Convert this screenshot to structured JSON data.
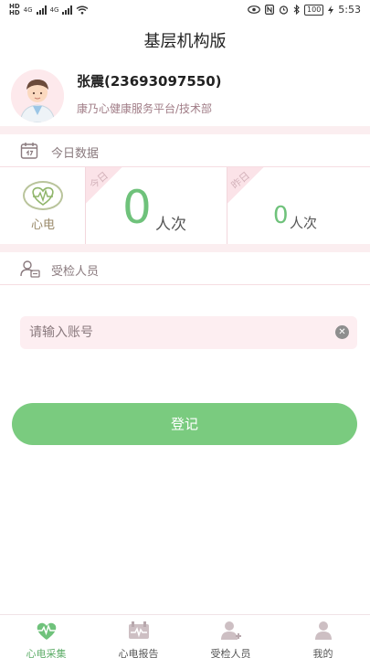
{
  "status_bar": {
    "carrier_1": "HD",
    "carrier_2": "HD",
    "net_1": "4G",
    "net_2": "4G",
    "battery": "100",
    "time": "5:53"
  },
  "header": {
    "title": "基层机构版"
  },
  "user": {
    "name": "张震(23693097550)",
    "org": "康乃心健康服务平台/技术部"
  },
  "today_section": {
    "label": "今日数据"
  },
  "stats": {
    "type_label": "心电",
    "today": {
      "tag": "今日",
      "value": "0",
      "unit": "人次"
    },
    "yesterday": {
      "tag": "昨日",
      "value": "0",
      "unit": "人次"
    }
  },
  "subject_section": {
    "label": "受检人员"
  },
  "account_input": {
    "placeholder": "请输入账号",
    "value": ""
  },
  "login_button": {
    "label": "登记"
  },
  "tabbar": {
    "items": [
      {
        "label": "心电采集",
        "icon": "heart-icon",
        "active": true
      },
      {
        "label": "心电报告",
        "icon": "report-icon",
        "active": false
      },
      {
        "label": "受检人员",
        "icon": "person-add-icon",
        "active": false
      },
      {
        "label": "我的",
        "icon": "person-icon",
        "active": false
      }
    ]
  },
  "colors": {
    "accent_green": "#7acb7f",
    "pink_bg": "#fbeef0",
    "input_bg": "#fdeef1"
  }
}
